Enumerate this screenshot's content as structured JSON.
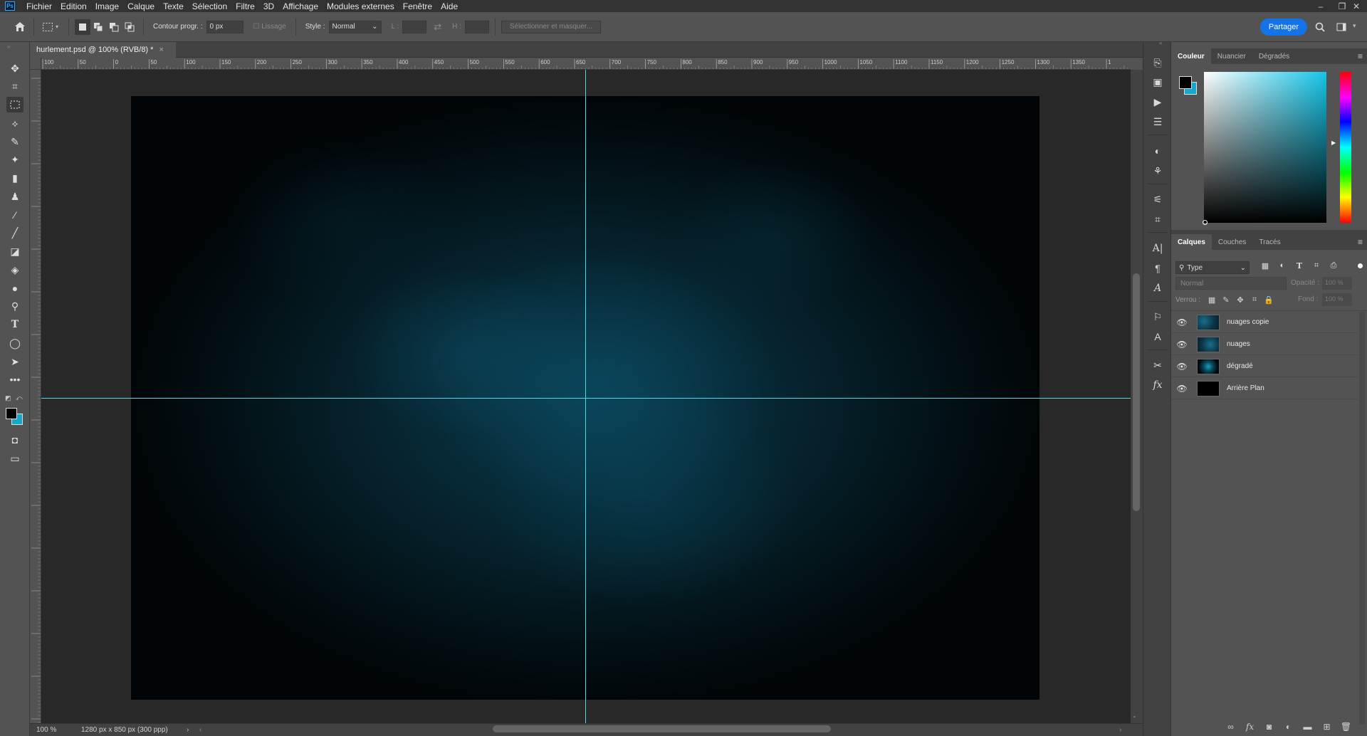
{
  "menubar": {
    "logo": "Ps",
    "items": [
      "Fichier",
      "Edition",
      "Image",
      "Calque",
      "Texte",
      "Sélection",
      "Filtre",
      "3D",
      "Affichage",
      "Modules externes",
      "Fenêtre",
      "Aide"
    ],
    "window_controls": [
      "–",
      "❐",
      "✕"
    ]
  },
  "options": {
    "contour_label": "Contour progr. :",
    "contour_value": "0 px",
    "lissage_label": "Lissage",
    "style_label": "Style :",
    "style_value": "Normal",
    "l_label": "L :",
    "h_label": "H :",
    "select_mask_label": "Sélectionner et masquer...",
    "share_button": "Partager"
  },
  "document": {
    "tab_title": "hurlement.psd @ 100% (RVB/8) *",
    "close": "×",
    "zoom": "100 %",
    "dimensions": "1280 px x 850 px (300 ppp)"
  },
  "ruler": {
    "horizontal": [
      "100",
      "50",
      "0",
      "50",
      "100",
      "150",
      "200",
      "250",
      "300",
      "350",
      "400",
      "450",
      "500",
      "550",
      "600",
      "650",
      "700",
      "750",
      "800",
      "850",
      "900",
      "950",
      "1000",
      "1050",
      "1100",
      "1150",
      "1200",
      "1250",
      "1300",
      "1350",
      "1"
    ]
  },
  "color_panel": {
    "tabs": [
      "Couleur",
      "Nuancier",
      "Dégradés"
    ],
    "foreground": "#000000",
    "background": "#15a8cf"
  },
  "layers_panel": {
    "tabs": [
      "Calques",
      "Couches",
      "Tracés"
    ],
    "filter_label": "Type",
    "blend_mode": "Normal",
    "opacity_label": "Opacité :",
    "opacity_value": "100 %",
    "lock_label": "Verrou :",
    "fill_label": "Fond :",
    "fill_value": "100 %",
    "layers": [
      {
        "name": "nuages copie",
        "thumb": "clouds"
      },
      {
        "name": "nuages",
        "thumb": "clouds"
      },
      {
        "name": "dégradé",
        "thumb": "gradient"
      },
      {
        "name": "Arrière Plan",
        "thumb": "black"
      }
    ]
  },
  "icons": {
    "home": "home-icon",
    "search": "search-icon",
    "workspace": "workspace-icon"
  },
  "colors": {
    "accent": "#1473e6",
    "guide": "#4fd9e4"
  }
}
